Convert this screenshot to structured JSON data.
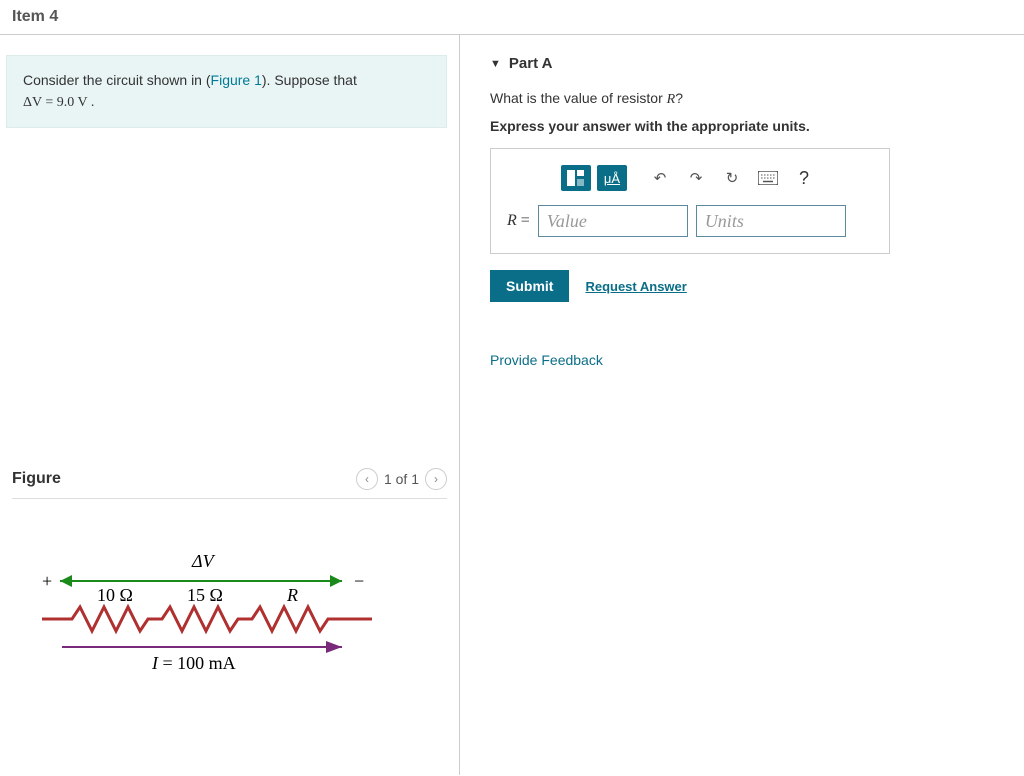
{
  "header": {
    "title": "Item 4"
  },
  "prompt": {
    "pre": "Consider the circuit shown in (",
    "figure_link": "Figure 1",
    "post": "). Suppose that ",
    "equation": "ΔV = 9.0  V ."
  },
  "figure": {
    "title": "Figure",
    "counter": "1 of 1"
  },
  "circuit": {
    "plus": "+",
    "minus": "−",
    "dv": "ΔV",
    "r1": "10 Ω",
    "r2": "15 Ω",
    "r3": "R",
    "current": "I = 100 mA"
  },
  "partA": {
    "label": "Part A",
    "question_pre": "What is the value of resistor ",
    "question_var": "R",
    "question_post": "?",
    "instruction": "Express your answer with the appropriate units.",
    "eq_label_var": "R",
    "eq_label_post": " = ",
    "value_placeholder": "Value",
    "units_placeholder": "Units",
    "toolbar": {
      "mu": "μÅ",
      "q": "?"
    },
    "submit": "Submit",
    "request": "Request Answer"
  },
  "feedback": "Provide Feedback"
}
